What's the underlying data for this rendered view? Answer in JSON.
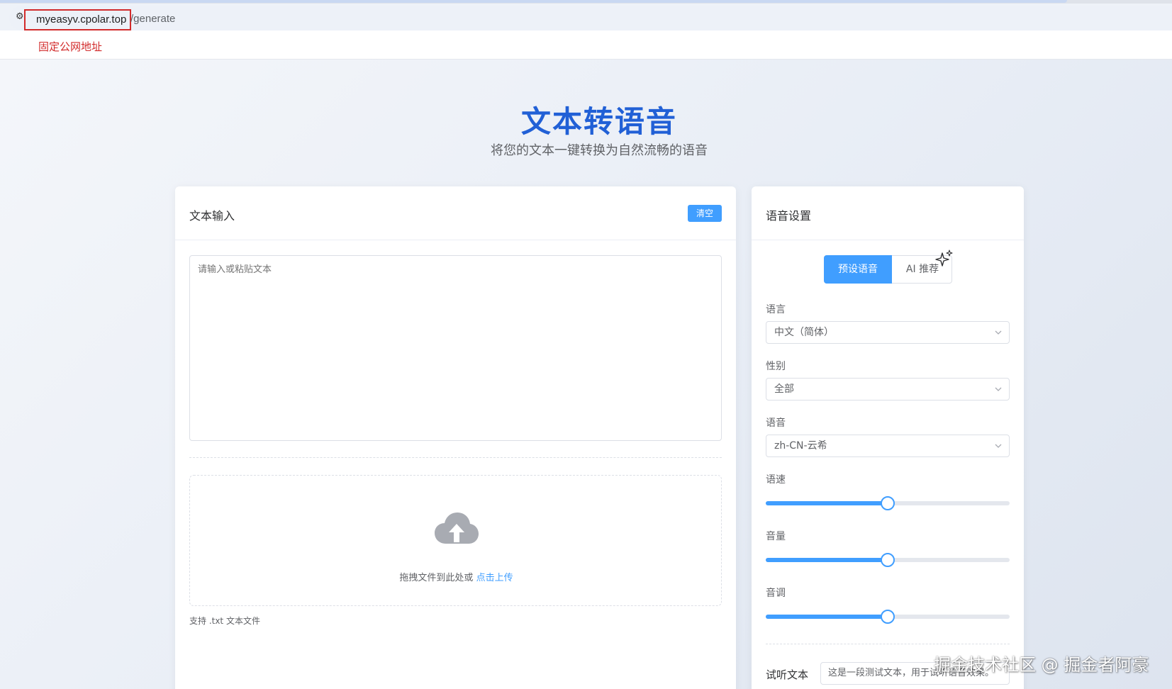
{
  "browser": {
    "url_host": "myeasyv.cpolar.top",
    "url_path": "/generate",
    "annotation": "固定公网地址"
  },
  "hero": {
    "title": "文本转语音",
    "subtitle": "将您的文本一键转换为自然流畅的语音"
  },
  "text_input": {
    "title": "文本输入",
    "clear_label": "清空",
    "placeholder": "请输入或粘贴文本",
    "upload_text": "拖拽文件到此处或 ",
    "upload_link": "点击上传",
    "upload_tip": "支持 .txt 文本文件"
  },
  "voice_settings": {
    "title": "语音设置",
    "tabs": [
      "预设语音",
      "AI 推荐"
    ],
    "language_label": "语言",
    "language_value": "中文（简体）",
    "gender_label": "性别",
    "gender_value": "全部",
    "voice_label": "语音",
    "voice_value": "zh-CN-云希",
    "rate_label": "语速",
    "rate_level": 0.5,
    "volume_label": "音量",
    "volume_level": 0.5,
    "pitch_label": "音调",
    "pitch_level": 0.5,
    "preview_label": "试听文本",
    "preview_value": "这是一段测试文本，用于试听语音效果。"
  },
  "watermark": "掘金技术社区 @ 掘金者阿豪",
  "colors": {
    "primary": "#409eff",
    "title_blue": "#2160d6",
    "annotation_red": "#d22b2b"
  }
}
